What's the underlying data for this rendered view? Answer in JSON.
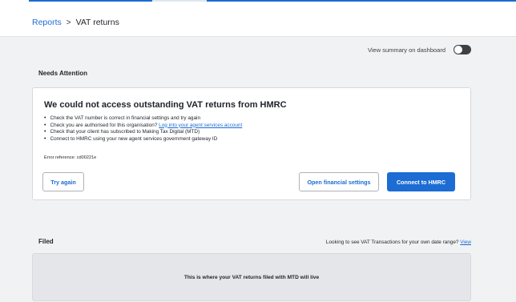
{
  "breadcrumb": {
    "parent": "Reports",
    "separator": ">",
    "current": "VAT returns"
  },
  "dashboard_toggle": {
    "label": "View summary on dashboard",
    "state": "off"
  },
  "needs_attention": {
    "heading": "Needs Attention",
    "title": "We could not access outstanding VAT returns from HMRC",
    "items": [
      {
        "text": "Check the VAT number is correct in financial settings and try again"
      },
      {
        "text": "Check you are authorised for this organisation? ",
        "link": "Log into your agent services account"
      },
      {
        "text": "Check that your client has subscribed to Making Tax Digital (MTD)"
      },
      {
        "text": "Connect to HMRC using your new agent services government gateway ID"
      }
    ],
    "error_reference": "Error reference: cd00221e",
    "buttons": {
      "try_again": "Try again",
      "open_settings": "Open financial settings",
      "connect": "Connect to HMRC"
    }
  },
  "filed": {
    "heading": "Filed",
    "note": "Looking to see VAT Transactions for your own date range? ",
    "note_link": "View",
    "empty_message": "This is where your VAT returns filed with MTD will live"
  },
  "colors": {
    "accent": "#1c6cd4",
    "background": "#f1f2f4",
    "panel": "#e4e6e9"
  },
  "icons": {
    "toggle": "toggle-switch-icon",
    "bullet": "bullet-icon"
  }
}
